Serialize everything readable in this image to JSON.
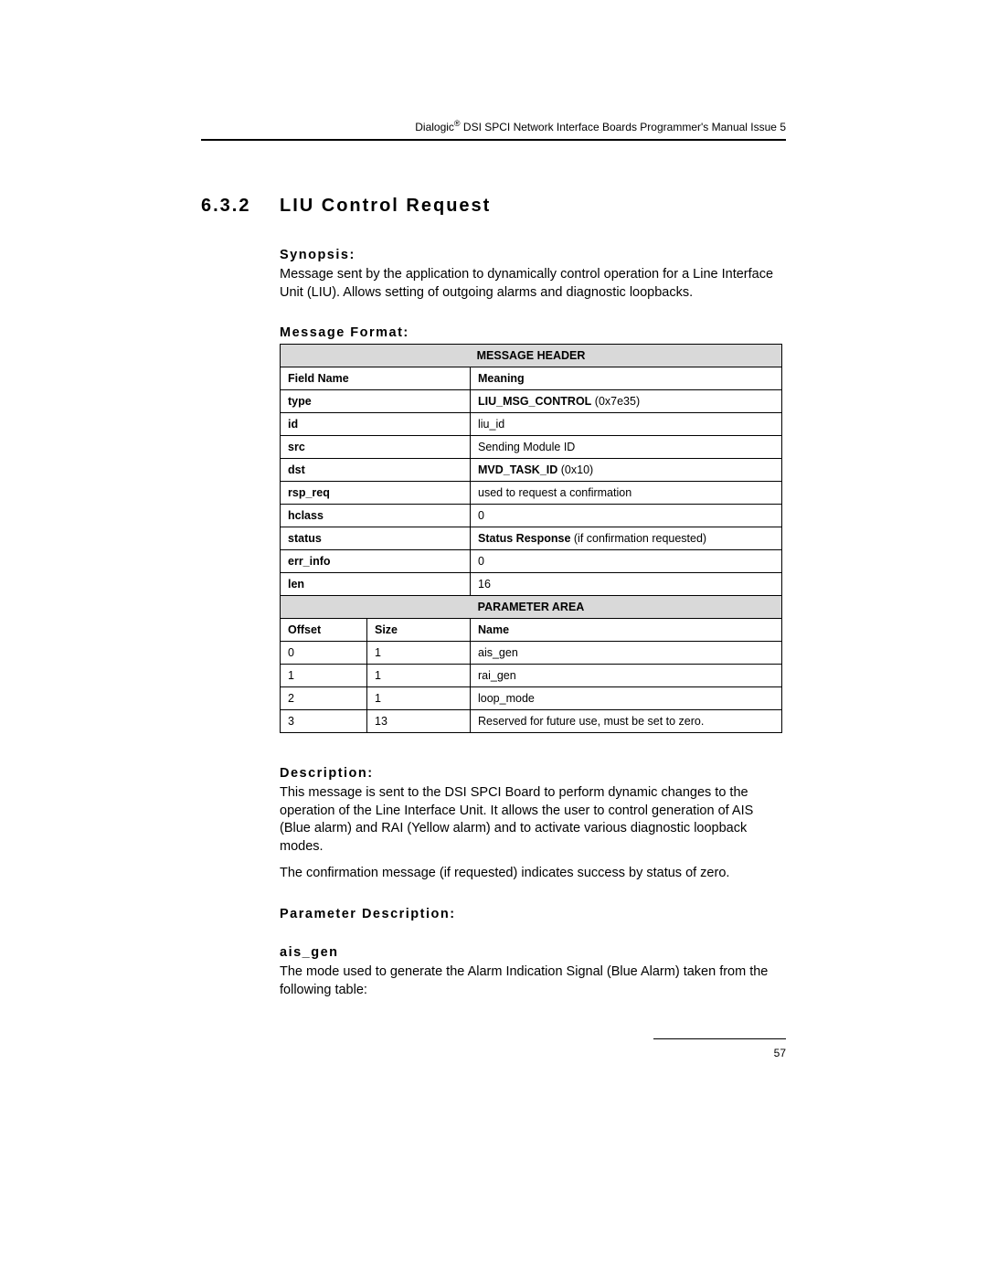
{
  "header": {
    "brand": "Dialogic",
    "reg": "®",
    "tail": " DSI SPCI Network Interface Boards Programmer's Manual Issue 5"
  },
  "section": {
    "number": "6.3.2",
    "title": "LIU Control Request"
  },
  "synopsis": {
    "label": "Synopsis:",
    "text": "Message sent by the application to dynamically control operation for a Line Interface Unit (LIU). Allows setting of outgoing alarms and diagnostic loopbacks."
  },
  "message_format_label": "Message Format:",
  "table": {
    "header_section": "MESSAGE HEADER",
    "col_field": "Field Name",
    "col_meaning": "Meaning",
    "rows": [
      {
        "field": "type",
        "meaning_bold": "LIU_MSG_CONTROL",
        "meaning_rest": " (0x7e35)"
      },
      {
        "field": "id",
        "meaning": "liu_id"
      },
      {
        "field": "src",
        "meaning": "Sending Module ID"
      },
      {
        "field": "dst",
        "meaning_bold": "MVD_TASK_ID",
        "meaning_rest": " (0x10)"
      },
      {
        "field": "rsp_req",
        "meaning": "used to request a confirmation"
      },
      {
        "field": "hclass",
        "meaning": "0"
      },
      {
        "field": "status",
        "meaning_bold": "Status Response",
        "meaning_rest": " (if confirmation requested)"
      },
      {
        "field": "err_info",
        "meaning": "0"
      },
      {
        "field": "len",
        "meaning": "16"
      }
    ],
    "param_section": "PARAMETER AREA",
    "col_offset": "Offset",
    "col_size": "Size",
    "col_name": "Name",
    "param_rows": [
      {
        "offset": "0",
        "size": "1",
        "name": "ais_gen"
      },
      {
        "offset": "1",
        "size": "1",
        "name": "rai_gen"
      },
      {
        "offset": "2",
        "size": "1",
        "name": "loop_mode"
      },
      {
        "offset": "3",
        "size": "13",
        "name": "Reserved for future use, must be set to zero."
      }
    ]
  },
  "description": {
    "label": "Description:",
    "p1": "This message is sent to the DSI SPCI Board to perform dynamic changes to the operation of the Line Interface Unit. It allows the user to control generation of AIS (Blue alarm) and RAI (Yellow alarm) and to activate various diagnostic loopback modes.",
    "p2": "The confirmation message (if requested) indicates success by status of zero."
  },
  "param_desc": {
    "label": "Parameter Description:",
    "p1_name": "ais_gen",
    "p1_text": "The mode used to generate the Alarm Indication Signal (Blue Alarm) taken from the following table:"
  },
  "page_number": "57"
}
